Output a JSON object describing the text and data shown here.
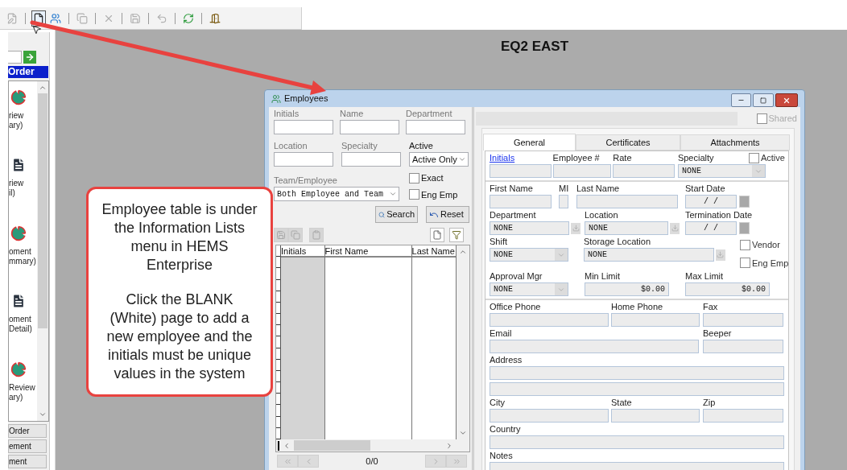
{
  "toolbar": {
    "buttons": [
      {
        "kind": "edit",
        "disabled": true,
        "hovered": false
      },
      {
        "kind": "new",
        "disabled": false,
        "hovered": true
      },
      {
        "kind": "people",
        "disabled": false,
        "hovered": false
      },
      {
        "kind": "copy",
        "disabled": true,
        "hovered": false
      },
      {
        "kind": "delete",
        "disabled": true,
        "hovered": false
      },
      {
        "kind": "save",
        "disabled": true,
        "hovered": false
      },
      {
        "kind": "undo",
        "disabled": true,
        "hovered": false
      },
      {
        "kind": "refresh",
        "disabled": false,
        "hovered": false
      },
      {
        "kind": "exit",
        "disabled": false,
        "hovered": false
      }
    ]
  },
  "sidebar": {
    "header": "Order",
    "items": [
      {
        "kind": "pie",
        "lines": [
          "riew",
          "ary)"
        ]
      },
      {
        "kind": "report",
        "lines": [
          "riew",
          "il)"
        ]
      },
      {
        "kind": "pie",
        "lines": [
          "oment",
          "mmary)"
        ]
      },
      {
        "kind": "report",
        "lines": [
          "oment",
          "Detail)"
        ]
      },
      {
        "kind": "pie",
        "lines": [
          "Review",
          "ary)"
        ]
      }
    ],
    "buttons": [
      "Order",
      "ement",
      "ment"
    ]
  },
  "canvas_title": "EQ2 EAST",
  "window": {
    "title": "Employees",
    "search": {
      "fields": [
        {
          "label": "Initials",
          "enabled": false
        },
        {
          "label": "Name",
          "enabled": false
        },
        {
          "label": "Department",
          "enabled": false
        },
        {
          "label": "Location",
          "enabled": false
        },
        {
          "label": "Specialty",
          "enabled": false
        }
      ],
      "active": {
        "label": "Active",
        "value": "Active Only"
      },
      "team": {
        "label": "Team/Employee",
        "value": "Both Employee and Team"
      },
      "checkboxes": [
        {
          "label": "Exact",
          "checked": false
        },
        {
          "label": "Eng Emp",
          "checked": false
        }
      ],
      "buttons": [
        {
          "kind": "search",
          "label": "Search"
        },
        {
          "kind": "reset",
          "label": "Reset"
        }
      ]
    },
    "grid_tools": [
      {
        "kind": "save",
        "disabled": true
      },
      {
        "kind": "copy",
        "disabled": true
      },
      {
        "kind": "paste",
        "disabled": true
      },
      {
        "kind": "new",
        "disabled": false
      },
      {
        "kind": "filter",
        "disabled": false
      }
    ],
    "grid": {
      "columns": [
        "Initials",
        "First Name",
        "Last Name"
      ]
    },
    "pager": {
      "text": "0/0",
      "buttons": [
        {
          "kind": "first",
          "disabled": true
        },
        {
          "kind": "prev",
          "disabled": true
        },
        {
          "kind": "next",
          "disabled": true
        },
        {
          "kind": "last",
          "disabled": true
        }
      ]
    },
    "shared": {
      "label": "Shared",
      "checked": false
    },
    "tabs": [
      {
        "label": "General",
        "selected": true
      },
      {
        "label": "Certificates",
        "selected": false
      },
      {
        "label": "Attachments",
        "selected": false
      }
    ],
    "sections": [
      {
        "fields": [
          {
            "kind": "link",
            "label": "Initials"
          },
          {
            "kind": "text",
            "label": "Employee #"
          },
          {
            "kind": "text",
            "label": "Rate"
          },
          {
            "kind": "combo",
            "label": "Specialty",
            "value": "NONE"
          },
          {
            "kind": "checkbox",
            "label": "Active",
            "checked": false
          }
        ]
      },
      {
        "fields": [
          {
            "kind": "text",
            "label": "First Name"
          },
          {
            "kind": "text",
            "label": "MI"
          },
          {
            "kind": "text",
            "label": "Last Name"
          },
          {
            "kind": "date",
            "label": "Start Date",
            "value": "/ /"
          },
          {
            "kind": "lookup",
            "label": "Department",
            "value": "NONE"
          },
          {
            "kind": "lookup",
            "label": "Location",
            "value": "NONE"
          },
          {
            "kind": "date",
            "label": "Termination Date",
            "value": "/ /"
          },
          {
            "kind": "combo",
            "label": "Shift",
            "value": "NONE"
          },
          {
            "kind": "lookup",
            "label": "Storage Location",
            "value": "NONE"
          },
          {
            "kind": "checks",
            "items": [
              {
                "label": "Vendor",
                "checked": false
              },
              {
                "label": "Eng Emp",
                "checked": false
              }
            ]
          },
          {
            "kind": "combo",
            "label": "Approval Mgr",
            "value": "NONE"
          },
          {
            "kind": "money",
            "label": "Min Limit",
            "value": "$0.00"
          },
          {
            "kind": "money",
            "label": "Max Limit",
            "value": "$0.00"
          }
        ]
      },
      {
        "fields": [
          {
            "kind": "text",
            "label": "Office Phone"
          },
          {
            "kind": "text",
            "label": "Home Phone"
          },
          {
            "kind": "text",
            "label": "Fax"
          },
          {
            "kind": "text",
            "label": "Email"
          },
          {
            "kind": "text",
            "label": "Beeper"
          },
          {
            "kind": "text",
            "label": "Address"
          },
          {
            "kind": "text"
          },
          {
            "kind": "text",
            "label": "City"
          },
          {
            "kind": "text",
            "label": "State"
          },
          {
            "kind": "text",
            "label": "Zip"
          },
          {
            "kind": "text",
            "label": "Country"
          },
          {
            "kind": "textarea",
            "label": "Notes"
          }
        ]
      }
    ]
  },
  "callout": {
    "paragraphs": [
      "Employee table is under the Information Lists menu in HEMS Enterprise",
      "Click the BLANK (White) page to add a new employee and the initials must be unique values in the system"
    ]
  }
}
